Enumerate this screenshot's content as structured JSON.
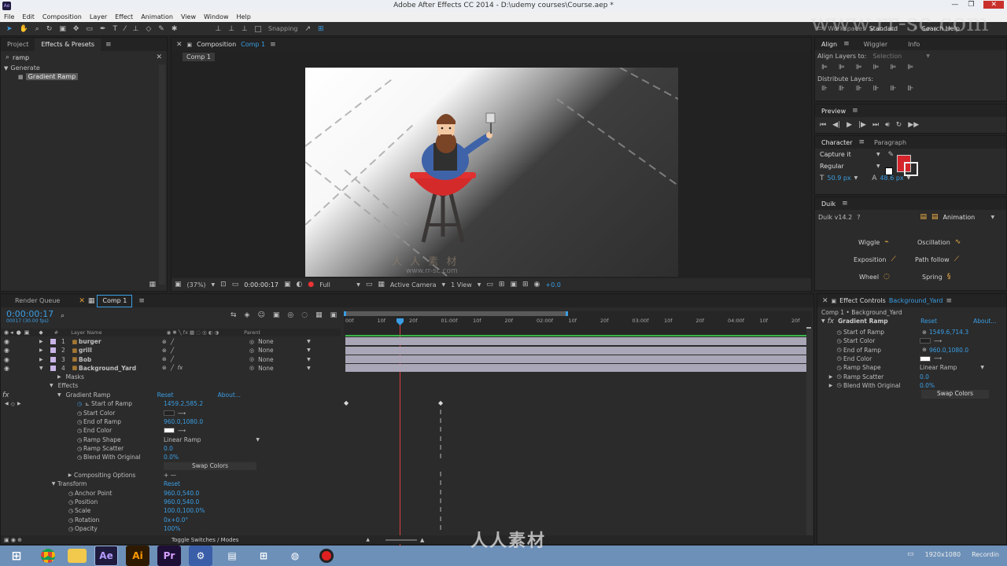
{
  "window": {
    "title": "Adobe After Effects CC 2014 - D:\\udemy courses\\Course.aep *",
    "app_icon": "after-effects-icon"
  },
  "menu": [
    "File",
    "Edit",
    "Composition",
    "Layer",
    "Effect",
    "Animation",
    "View",
    "Window",
    "Help"
  ],
  "toolbar": {
    "snapping": "Snapping",
    "workspace_label": "Workspace:",
    "workspace_value": "Standard",
    "search_help": "Search Help"
  },
  "left_panel": {
    "tabs": [
      "Project",
      "Effects & Presets"
    ],
    "search_value": "ramp",
    "category": "Generate",
    "item": "Gradient Ramp"
  },
  "comp_panel": {
    "tab_label": "Composition",
    "tab_comp": "Comp 1",
    "sub_tab": "Comp 1",
    "zoom": "(37%)",
    "timecode": "0:00:00:17",
    "resolution": "Full",
    "camera": "Active Camera",
    "view": "1 View",
    "exposure": "+0.0",
    "watermark_cn": "人 人 素 材",
    "watermark_url": "www.rr-sc.com"
  },
  "align_panel": {
    "tabs": [
      "Align",
      "Wiggler",
      "Info"
    ],
    "align_to_label": "Align Layers to:",
    "align_to_value": "Selection",
    "distribute_label": "Distribute Layers:"
  },
  "preview_panel": {
    "title": "Preview"
  },
  "character_panel": {
    "tabs": [
      "Character",
      "Paragraph"
    ],
    "font": "Capture it",
    "style": "Regular",
    "size": "50.9 px",
    "leading": "48.6 px",
    "fill_color": "#d4252b"
  },
  "duik_panel": {
    "title": "Duik",
    "version": "Duik v14.2",
    "help": "?",
    "mode": "Animation",
    "buttons": [
      "Wiggle",
      "Oscillation",
      "Exposition",
      "Path follow",
      "Wheel",
      "Spring"
    ]
  },
  "timeline": {
    "tabs": [
      "Render Queue",
      "Comp 1"
    ],
    "timecode": "0:00:00:17",
    "fps": "00017 (30.00 fps)",
    "col_layer_name": "Layer Name",
    "col_parent": "Parent",
    "ruler": [
      "00f",
      "10f",
      "20f",
      "01:00f",
      "10f",
      "20f",
      "02:00f",
      "10f",
      "20f",
      "03:00f",
      "10f",
      "20f",
      "04:00f",
      "10f",
      "20f"
    ],
    "layers": [
      {
        "num": "1",
        "name": "burger",
        "parent": "None",
        "color": "#c8b4e6"
      },
      {
        "num": "2",
        "name": "grill",
        "parent": "None",
        "color": "#c8b4e6"
      },
      {
        "num": "3",
        "name": "Bob",
        "parent": "None",
        "color": "#c8b4e6"
      },
      {
        "num": "4",
        "name": "Background_Yard",
        "parent": "None",
        "color": "#c8b4e6"
      }
    ],
    "props": {
      "masks": "Masks",
      "effects": "Effects",
      "gradient_ramp": "Gradient Ramp",
      "reset": "Reset",
      "about": "About...",
      "start_of_ramp": "Start of Ramp",
      "start_of_ramp_val": "1459.2,585.2",
      "start_color": "Start Color",
      "end_of_ramp": "End of Ramp",
      "end_of_ramp_val": "960.0,1080.0",
      "end_color": "End Color",
      "ramp_shape": "Ramp Shape",
      "ramp_shape_val": "Linear Ramp",
      "ramp_scatter": "Ramp Scatter",
      "ramp_scatter_val": "0.0",
      "blend": "Blend With Original",
      "blend_val": "0.0%",
      "swap": "Swap Colors",
      "compositing": "Compositing Options",
      "compositing_val": "+ —",
      "transform": "Transform",
      "transform_reset": "Reset",
      "anchor": "Anchor Point",
      "anchor_val": "960.0,540.0",
      "position": "Position",
      "position_val": "960.0,540.0",
      "scale": "Scale",
      "scale_val": "100.0,100.0%",
      "rotation": "Rotation",
      "rotation_val": "0x+0.0°",
      "opacity": "Opacity",
      "opacity_val": "100%"
    },
    "toggle": "Toggle Switches / Modes"
  },
  "effect_controls": {
    "title": "Effect Controls",
    "layer": "Background_Yard",
    "crumb": "Comp 1 • Background_Yard",
    "effect": "Gradient Ramp",
    "reset": "Reset",
    "about": "About...",
    "start_of_ramp": "Start of Ramp",
    "start_of_ramp_val": "1549.6,714.3",
    "start_color": "Start Color",
    "end_of_ramp": "End of Ramp",
    "end_of_ramp_val": "960.0,1080.0",
    "end_color": "End Color",
    "ramp_shape": "Ramp Shape",
    "ramp_shape_val": "Linear Ramp",
    "ramp_scatter": "Ramp Scatter",
    "ramp_scatter_val": "0.0",
    "blend": "Blend With Original",
    "blend_val": "0.0%",
    "swap": "Swap Colors"
  },
  "taskbar": {
    "apps": [
      "windows-start-icon",
      "chrome-icon",
      "explorer-icon",
      "after-effects-icon",
      "illustrator-icon",
      "premiere-icon",
      "settings-icon",
      "files-icon",
      "network-icon",
      "media-icon",
      "record-icon"
    ],
    "ae_label": "Ae",
    "ai_label": "Ai",
    "pr_label": "Pr",
    "status_res": "1920x1080",
    "status_rec": "Recordin"
  },
  "watermark_bottom": "人人素材",
  "watermark_top": "www.rr-sc.com"
}
